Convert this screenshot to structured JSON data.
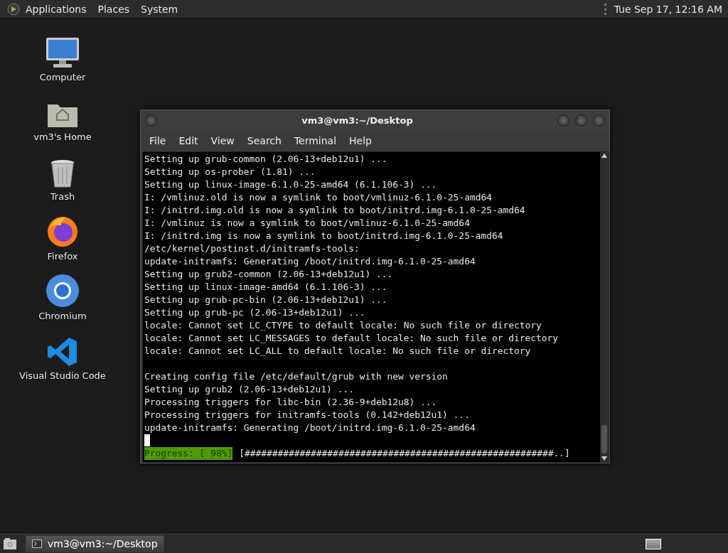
{
  "top_panel": {
    "menus": [
      "Applications",
      "Places",
      "System"
    ],
    "clock": "Tue Sep 17, 12:16 AM"
  },
  "desktop_icons": [
    {
      "kind": "computer",
      "label": "Computer"
    },
    {
      "kind": "home",
      "label": "vm3's Home"
    },
    {
      "kind": "trash",
      "label": "Trash"
    },
    {
      "kind": "firefox",
      "label": "Firefox"
    },
    {
      "kind": "chromium",
      "label": "Chromium"
    },
    {
      "kind": "vscode",
      "label": "Visual Studio Code"
    }
  ],
  "terminal": {
    "title": "vm3@vm3:~/Desktop",
    "menu": [
      "File",
      "Edit",
      "View",
      "Search",
      "Terminal",
      "Help"
    ],
    "blocks": [
      {
        "lines": [
          "Setting up grub-common (2.06-13+deb12u1) ...",
          "Setting up os-prober (1.81) ...",
          "Setting up linux-image-6.1.0-25-amd64 (6.1.106-3) ...",
          "I: /vmlinuz.old is now a symlink to boot/vmlinuz-6.1.0-25-amd64",
          "I: /initrd.img.old is now a symlink to boot/initrd.img-6.1.0-25-amd64",
          "I: /vmlinuz is now a symlink to boot/vmlinuz-6.1.0-25-amd64",
          "I: /initrd.img is now a symlink to boot/initrd.img-6.1.0-25-amd64",
          "/etc/kernel/postinst.d/initramfs-tools:",
          "update-initramfs: Generating /boot/initrd.img-6.1.0-25-amd64",
          "Setting up grub2-common (2.06-13+deb12u1) ...",
          "Setting up linux-image-amd64 (6.1.106-3) ...",
          "Setting up grub-pc-bin (2.06-13+deb12u1) ...",
          "Setting up grub-pc (2.06-13+deb12u1) ...",
          "locale: Cannot set LC_CTYPE to default locale: No such file or directory",
          "locale: Cannot set LC_MESSAGES to default locale: No such file or directory",
          "locale: Cannot set LC_ALL to default locale: No such file or directory"
        ]
      },
      {
        "lines": [
          "Creating config file /etc/default/grub with new version",
          "Setting up grub2 (2.06-13+deb12u1) ...",
          "Processing triggers for libc-bin (2.36-9+deb12u8) ...",
          "Processing triggers for initramfs-tools (0.142+deb12u1) ...",
          "update-initramfs: Generating /boot/initrd.img-6.1.0-25-amd64"
        ]
      }
    ],
    "progress": {
      "label": "Progress: [ 98%]",
      "bar": "[########################################################..]"
    }
  },
  "taskbar": {
    "tasks": [
      {
        "label": "vm3@vm3:~/Desktop",
        "selected": true
      }
    ]
  }
}
